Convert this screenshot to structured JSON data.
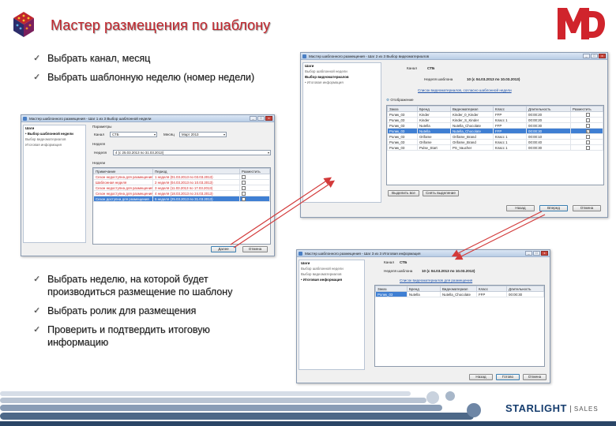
{
  "title": "Мастер размещения по шаблону",
  "logo_text": "MD",
  "brand": {
    "name": "STARLIGHT",
    "sub": "SALES"
  },
  "bullets_top": [
    "Выбрать канал, месяц",
    "Выбрать шаблонную неделю (номер недели)"
  ],
  "bullets_bottom": [
    "Выбрать неделю, на которой будет производиться размещение по шаблону",
    "Выбрать ролик для размещения",
    "Проверить и подтвердить итоговую информацию"
  ],
  "colors": {
    "title": "#c0262d",
    "accent": "#163d6e",
    "arrow": "#d33a3a"
  },
  "win1": {
    "title": "Мастер шаблонного размещения - Шаг 1 из 3 Выбор шаблонной недели",
    "steps": [
      "Шаги",
      "• Выбор шаблонной недели",
      "Выбор видеоматериалов",
      "Итоговая информация"
    ],
    "section_params": "Параметры",
    "channel_label": "Канал",
    "channel_value": "СТБ",
    "month_label": "Месяц",
    "month_value": "Март 2013",
    "section_week": "Неделя",
    "week_label": "Неделя",
    "week_value": "4 (с 25.03.2013 по 31.03.2013)",
    "section_weeks": "Недели",
    "columns": [
      "Примечание",
      "Период",
      "Разместить"
    ],
    "rows": [
      [
        "Сезон недоступна для размещения",
        "1 неделя (01.03.2013 по 03.03.2013)",
        ""
      ],
      [
        "Шаблонная неделя",
        "2 неделя (04.03.2013 по 10.03.2013)",
        ""
      ],
      [
        "Сезон недоступна для размещения",
        "3 неделя (11.03.2013 по 17.03.2013)",
        ""
      ],
      [
        "Сезон недоступна для размещения",
        "4 неделя (18.03.2013 по 24.03.2013)",
        ""
      ],
      [
        "Сезон доступна для размещения",
        "5 неделя (25.03.2013 по 31.03.2013)",
        "✓"
      ]
    ],
    "btn_next": "Далее",
    "btn_cancel": "Отмена"
  },
  "win2": {
    "title": "Мастер шаблонного размещения - Шаг 2 из 3 Выбор видеоматериалов",
    "steps": [
      "Шаги",
      "Выбор шаблонной недели",
      "Выбор видеоматериалов",
      "• Итоговая информация"
    ],
    "channel_label": "Канал",
    "channel_value": "СТБ",
    "week_label": "Неделя шаблона",
    "week_value": "10 (с 04.03.2013 по 10.03.2013)",
    "list_label": "Список видеоматериалов, согласно шаблонной недели",
    "toolbar_label": "Отображение",
    "columns": [
      "Заказ",
      "Бренд",
      "Видеоматериал",
      "Класс",
      "Длительность",
      "Разместить"
    ],
    "rows": [
      [
        "Ролик_03",
        "Kinder",
        "Kinder_0_Kinder",
        "FFP",
        "00:00:20",
        ""
      ],
      [
        "Ролик_03",
        "Kinder",
        "Kinder_S_Kinder",
        "Класс 1",
        "00:00:20",
        ""
      ],
      [
        "Ролик_03",
        "Nutella",
        "Nutella_Chocolate",
        "FFP",
        "00:00:30",
        ""
      ],
      [
        "Ролик_03",
        "Nutella",
        "Nutella_Chocolate",
        "FFP",
        "00:00:30",
        "✓"
      ],
      [
        "Ролик_03",
        "Orifame",
        "Orifame_Brand",
        "Класс 1",
        "00:00:10",
        ""
      ],
      [
        "Ролик_03",
        "Orifame",
        "Orifame_Brand",
        "Класс 1",
        "00:00:40",
        ""
      ],
      [
        "Ролик_03",
        "Pulse_Start",
        "PS_Vaucher",
        "Класс 1",
        "00:00:30",
        ""
      ]
    ],
    "btn_left1": "Выделить все",
    "btn_left2": "Снять выделение",
    "btn_back": "Назад",
    "btn_next": "Вперед",
    "btn_cancel": "Отмена"
  },
  "win3": {
    "title": "Мастер шаблонного размещения - Шаг 3 из 3 Итоговая информация",
    "steps": [
      "Шаги",
      "Выбор шаблонной недели",
      "Выбор видеоматериалов",
      "• Итоговая информация"
    ],
    "channel_label": "Канал",
    "channel_value": "СТБ",
    "week_label": "Неделя шаблона",
    "week_value": "10 (с 04.03.2013 по 10.03.2013)",
    "list_label": "Список видеоматериалов для размещения",
    "columns": [
      "Заказ",
      "Бренд",
      "Видеоматериал",
      "Класс",
      "Длительность"
    ],
    "rows": [
      [
        "Ролик_03",
        "Nutella",
        "Nutella_Chocolate",
        "FFP",
        "00:00:30"
      ]
    ],
    "btn_back": "Назад",
    "btn_done": "Готово",
    "btn_cancel": "Отмена"
  }
}
